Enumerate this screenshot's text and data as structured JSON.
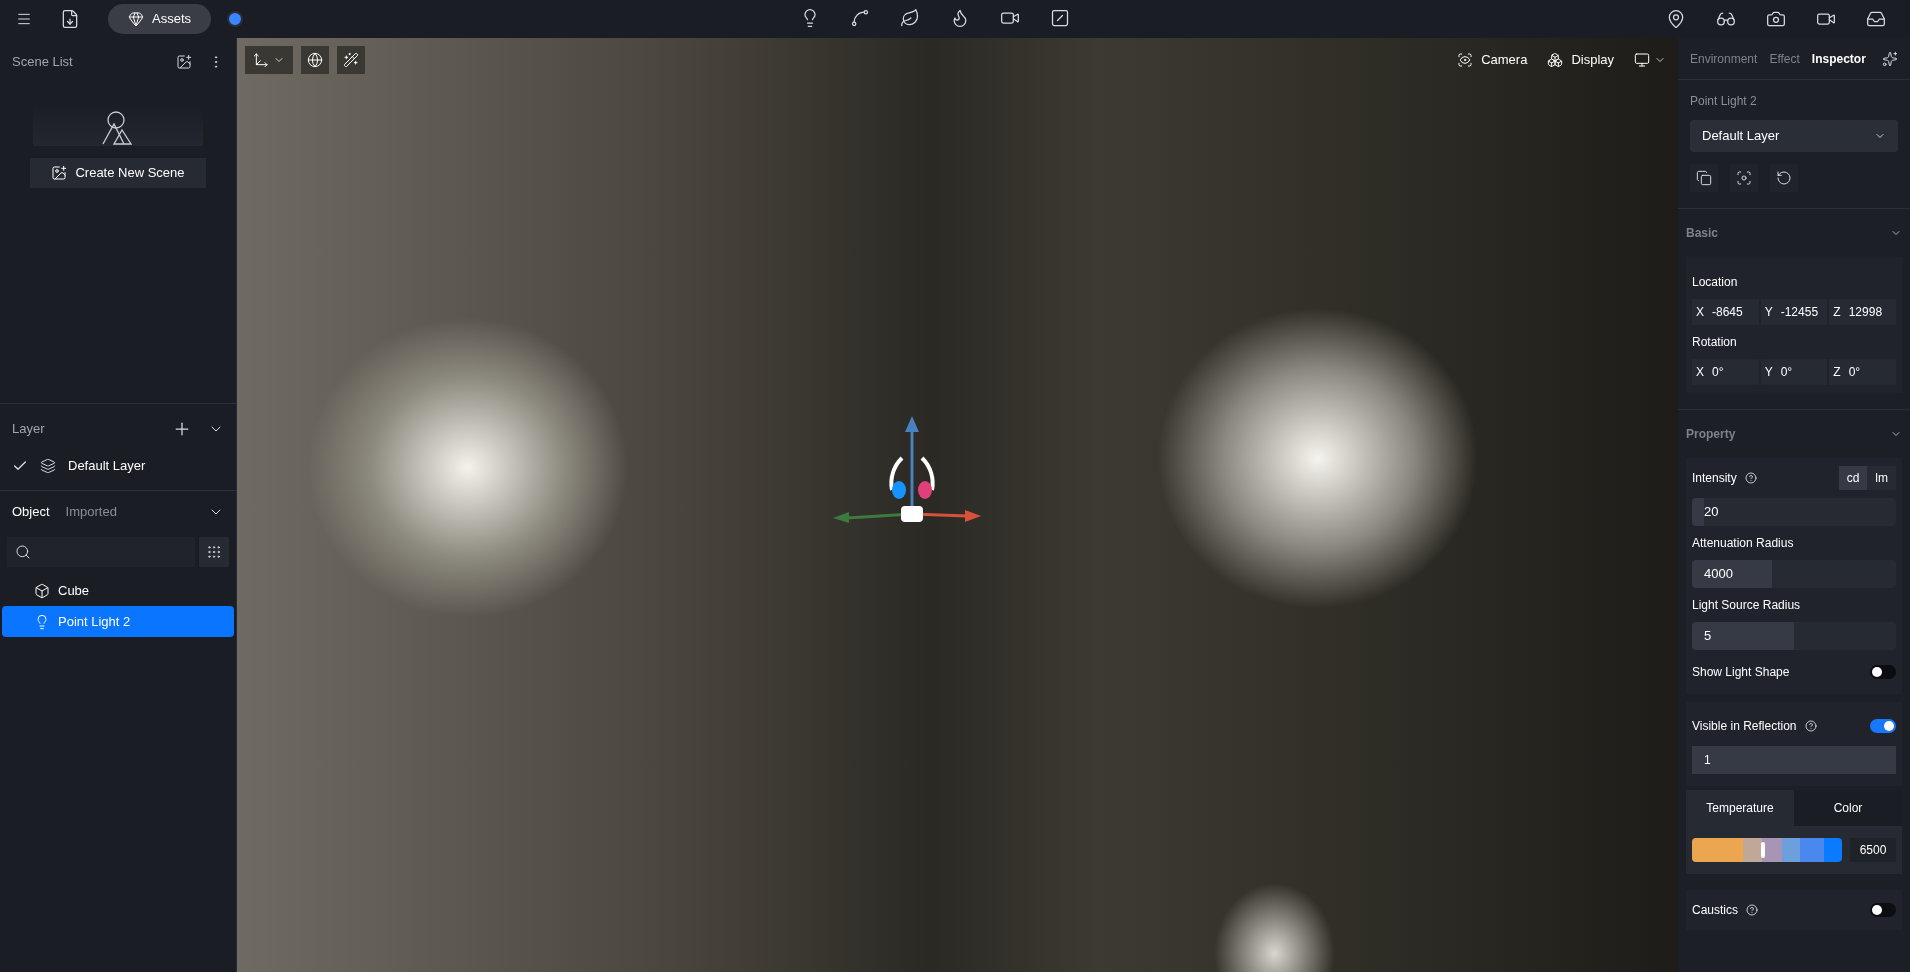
{
  "topbar": {
    "assets_label": "Assets"
  },
  "scene_list": {
    "title": "Scene List",
    "create_button": "Create New Scene"
  },
  "layer_panel": {
    "title": "Layer",
    "layers": [
      {
        "name": "Default Layer",
        "checked": true
      }
    ]
  },
  "object_panel": {
    "tabs": [
      {
        "label": "Object",
        "selected": true
      },
      {
        "label": "Imported",
        "selected": false
      }
    ],
    "items": [
      {
        "name": "Cube",
        "kind": "mesh",
        "selected": false
      },
      {
        "name": "Point Light 2",
        "kind": "light",
        "selected": true
      }
    ]
  },
  "viewport": {
    "camera_button": "Camera",
    "display_button": "Display"
  },
  "inspector": {
    "tabs": [
      {
        "label": "Environment",
        "selected": false
      },
      {
        "label": "Effect",
        "selected": false
      },
      {
        "label": "Inspector",
        "selected": true
      }
    ],
    "object_name": "Point Light 2",
    "layer_select": "Default Layer",
    "basic": {
      "title": "Basic",
      "location_label": "Location",
      "location": [
        {
          "axis": "X",
          "value": "-8645"
        },
        {
          "axis": "Y",
          "value": "-12455"
        },
        {
          "axis": "Z",
          "value": "12998"
        }
      ],
      "rotation_label": "Rotation",
      "rotation": [
        {
          "axis": "X",
          "value": "0°"
        },
        {
          "axis": "Y",
          "value": "0°"
        },
        {
          "axis": "Z",
          "value": "0°"
        }
      ]
    },
    "property": {
      "title": "Property",
      "intensity_label": "Intensity",
      "units": [
        {
          "label": "cd",
          "selected": true
        },
        {
          "label": "lm",
          "selected": false
        }
      ],
      "intensity": {
        "value": "20",
        "level": 0.06
      },
      "attenuation_label": "Attenuation Radius",
      "attenuation": {
        "value": "4000",
        "level": 0.39
      },
      "source_radius_label": "Light Source Radius",
      "source_radius": {
        "value": "5",
        "level": 0.5
      },
      "show_shape": {
        "label": "Show Light Shape",
        "on": false
      },
      "reflection": {
        "label": "Visible in Reflection",
        "on": true,
        "value": "1"
      },
      "color_tabs": [
        {
          "label": "Temperature",
          "selected": true
        },
        {
          "label": "Color",
          "selected": false
        }
      ],
      "temperature": {
        "level": 0.47,
        "value": "6500"
      },
      "caustics": {
        "label": "Caustics",
        "on": false
      }
    }
  }
}
